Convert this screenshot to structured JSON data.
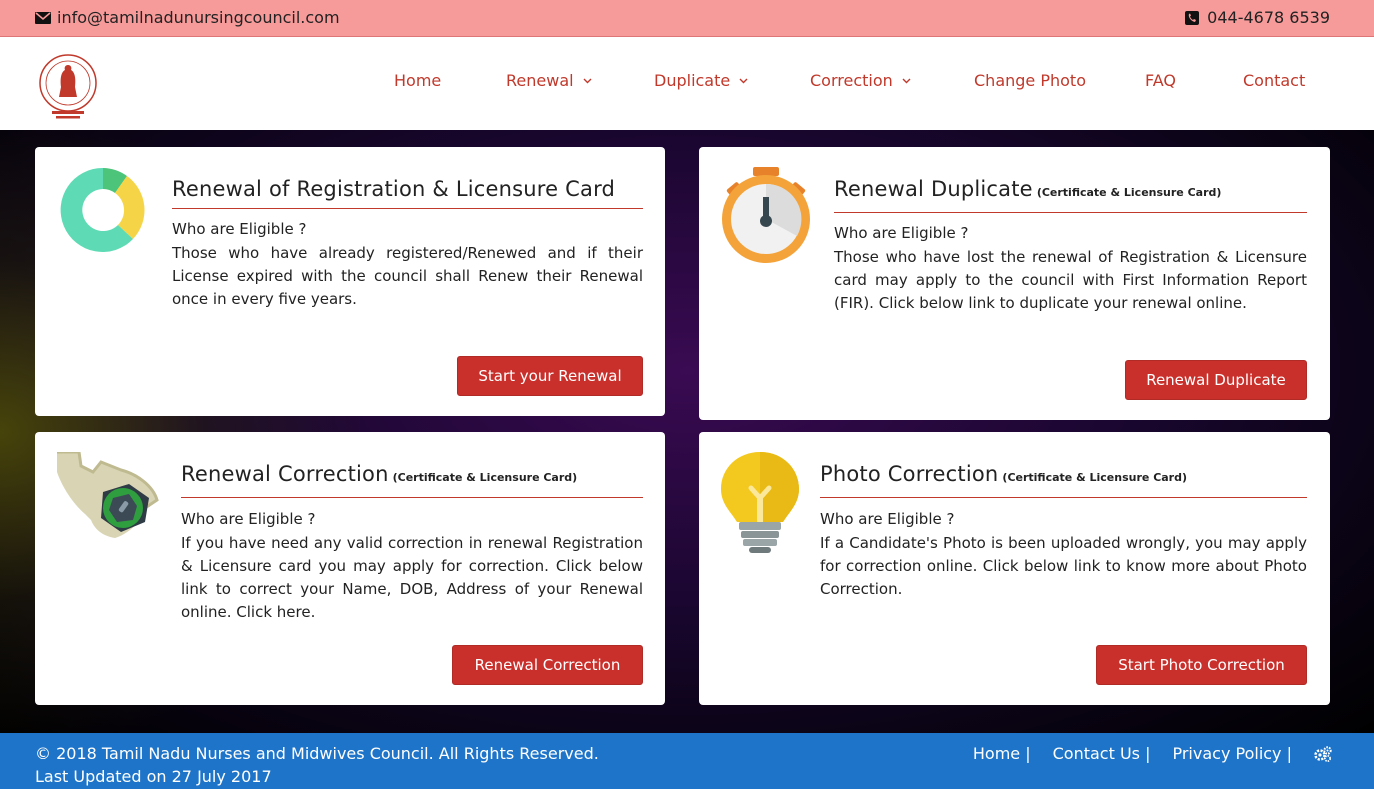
{
  "topbar": {
    "email": "info@tamilnadunursingcouncil.com",
    "phone": "044-4678 6539"
  },
  "nav": {
    "home": "Home",
    "renewal": "Renewal",
    "duplicate": "Duplicate",
    "correction": "Correction",
    "change_photo": "Change Photo",
    "faq": "FAQ",
    "contact": "Contact"
  },
  "cards": {
    "renewal": {
      "title": "Renewal of Registration & Licensure Card",
      "eligible": "Who are Eligible ?",
      "desc": "Those who have already registered/Renewed and if their License expired with the council shall Renew their Renewal once in every five years.",
      "button": "Start your Renewal"
    },
    "duplicate": {
      "title": "Renewal Duplicate",
      "subtitle": "(Certificate & Licensure Card)",
      "eligible": "Who are Eligible ?",
      "desc": "Those who have lost the renewal of Registration & Licensure card may apply to the council with First Information Report (FIR). Click below link to duplicate your renewal online.",
      "button": "Renewal Duplicate"
    },
    "correction": {
      "title": "Renewal Correction",
      "subtitle": "(Certificate & Licensure Card)",
      "eligible": "Who are Eligible ?",
      "desc": "If you have need any valid correction in renewal Registration & Licensure card you may apply for correction. Click below link to correct your Name, DOB, Address of your Renewal online. Click here.",
      "button": "Renewal Correction"
    },
    "photo": {
      "title": "Photo Correction",
      "subtitle": "(Certificate & Licensure Card)",
      "eligible": "Who are Eligible ?",
      "desc": "If a Candidate's Photo is been uploaded wrongly, you may apply for correction online. Click below link to know more about Photo Correction.",
      "button": "Start Photo Correction"
    }
  },
  "footer": {
    "copyright": "© 2018 Tamil Nadu Nurses and Midwives Council. All Rights Reserved.",
    "updated": "Last Updated on 27 July 2017",
    "home": "Home |",
    "contact": "Contact Us |",
    "privacy": "Privacy Policy |"
  },
  "icons": {
    "email": "envelope-icon",
    "phone": "phone-icon",
    "settings": "gears-icon"
  },
  "colors": {
    "accent": "#c9302c",
    "topbar": "#f79a9a",
    "footer": "#1e74c8"
  }
}
